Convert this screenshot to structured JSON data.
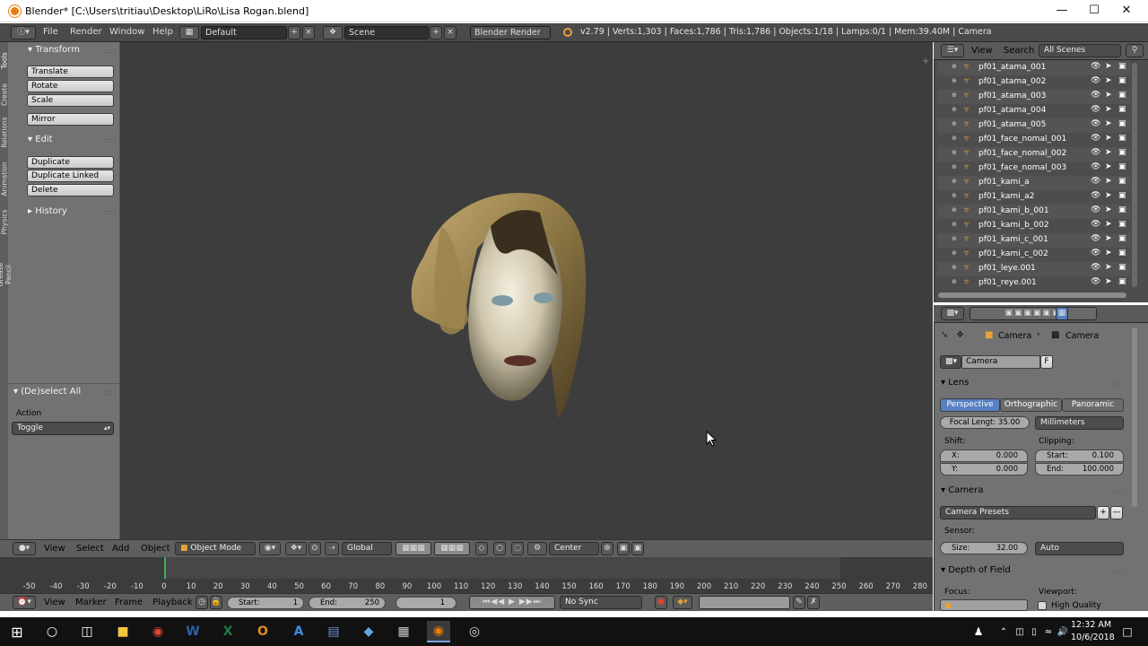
{
  "window": {
    "title": "Blender* [C:\\Users\\tritiau\\Desktop\\LiRo\\Lisa Rogan.blend]"
  },
  "info_header": {
    "menus": [
      "File",
      "Render",
      "Window",
      "Help"
    ],
    "layout": "Default",
    "scene": "Scene",
    "engine": "Blender Render",
    "stats": "v2.79 | Verts:1,303 | Faces:1,786 | Tris:1,786 | Objects:1/18 | Lamps:0/1 | Mem:39.40M | Camera"
  },
  "tool_shelf": {
    "tabs": [
      "Tools",
      "Create",
      "Relations",
      "Animation",
      "Physics",
      "Grease Pencil"
    ],
    "transform_title": "Transform",
    "transform_buttons": [
      "Translate",
      "Rotate",
      "Scale"
    ],
    "mirror": "Mirror",
    "edit_title": "Edit",
    "edit_buttons": [
      "Duplicate",
      "Duplicate Linked",
      "Delete"
    ],
    "history_title": "History",
    "operator_title": "(De)select All",
    "action_label": "Action",
    "action_value": "Toggle"
  },
  "view3d_header": {
    "menus": [
      "View",
      "Select",
      "Add",
      "Object"
    ],
    "mode": "Object Mode",
    "orientation": "Global",
    "pivot": "Center"
  },
  "timeline": {
    "ticks": [
      "-50",
      "-40",
      "-30",
      "-20",
      "-10",
      "0",
      "10",
      "20",
      "30",
      "40",
      "50",
      "60",
      "70",
      "80",
      "90",
      "100",
      "110",
      "120",
      "130",
      "140",
      "150",
      "160",
      "170",
      "180",
      "190",
      "200",
      "210",
      "220",
      "230",
      "240",
      "250",
      "260",
      "270",
      "280"
    ],
    "menus": [
      "View",
      "Marker",
      "Frame",
      "Playback"
    ],
    "start_label": "Start:",
    "start": "1",
    "end_label": "End:",
    "end": "250",
    "current": "1",
    "sync": "No Sync"
  },
  "outliner": {
    "view": "View",
    "search": "Search",
    "filter": "All Scenes",
    "items": [
      "pf01_atama_001",
      "pf01_atama_002",
      "pf01_atama_003",
      "pf01_atama_004",
      "pf01_atama_005",
      "pf01_face_nomal_001",
      "pf01_face_nomal_002",
      "pf01_face_nomal_003",
      "pf01_kami_a",
      "pf01_kami_a2",
      "pf01_kami_b_001",
      "pf01_kami_b_002",
      "pf01_kami_c_001",
      "pf01_kami_c_002",
      "pf01_leye.001",
      "pf01_reye.001"
    ]
  },
  "properties": {
    "breadcrumb_object": "Camera",
    "breadcrumb_data": "Camera",
    "datablock": "Camera",
    "datablock_flag": "F",
    "lens_title": "Lens",
    "projection": [
      "Perspective",
      "Orthographic",
      "Panoramic"
    ],
    "focal_length": "Focal Lengt: 35.00",
    "lens_unit": "Millimeters",
    "shift_label": "Shift:",
    "clipping_label": "Clipping:",
    "shift_x_label": "X:",
    "shift_x": "0.000",
    "shift_y_label": "Y:",
    "shift_y": "0.000",
    "clip_start_label": "Start:",
    "clip_start": "0.100",
    "clip_end_label": "End:",
    "clip_end": "100.000",
    "camera_title": "Camera",
    "presets": "Camera Presets",
    "sensor_label": "Sensor:",
    "size_label": "Size:",
    "size": "32.00",
    "sensor_fit": "Auto",
    "dof_title": "Depth of Field",
    "focus_label": "Focus:",
    "viewport_label": "Viewport:",
    "high_quality": "High Quality"
  },
  "taskbar": {
    "time": "12:32 AM",
    "date": "10/6/2018"
  },
  "colors": {
    "accent_blue": "#5680c2",
    "timeline_cursor": "#3fae5c"
  }
}
